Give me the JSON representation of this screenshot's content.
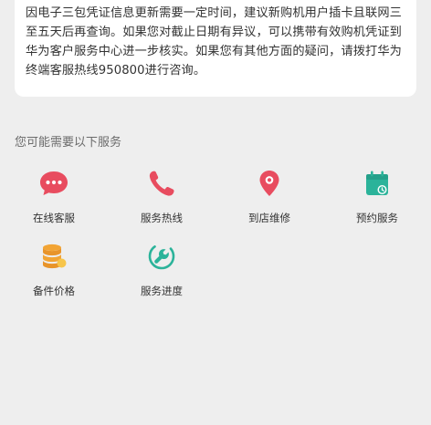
{
  "notice": {
    "text": "因电子三包凭证信息更新需要一定时间，建议新购机用户插卡且联网三至五天后再查询。如果您对截止日期有异议，可以携带有效购机凭证到华为客户服务中心进一步核实。如果您有其他方面的疑问，请拨打华为终端客服热线950800进行咨询。"
  },
  "services_section": {
    "title": "您可能需要以下服务",
    "items": [
      {
        "label": "在线客服",
        "icon": "chat-bubble-icon",
        "color": "#e84c5f"
      },
      {
        "label": "服务热线",
        "icon": "phone-icon",
        "color": "#e84c5f"
      },
      {
        "label": "到店维修",
        "icon": "location-pin-icon",
        "color": "#e84c5f"
      },
      {
        "label": "预约服务",
        "icon": "calendar-icon",
        "color": "#2bb39a"
      },
      {
        "label": "备件价格",
        "icon": "coin-stack-icon",
        "color": "#f2a434"
      },
      {
        "label": "服务进度",
        "icon": "wrench-progress-icon",
        "color": "#2bb39a"
      }
    ]
  }
}
